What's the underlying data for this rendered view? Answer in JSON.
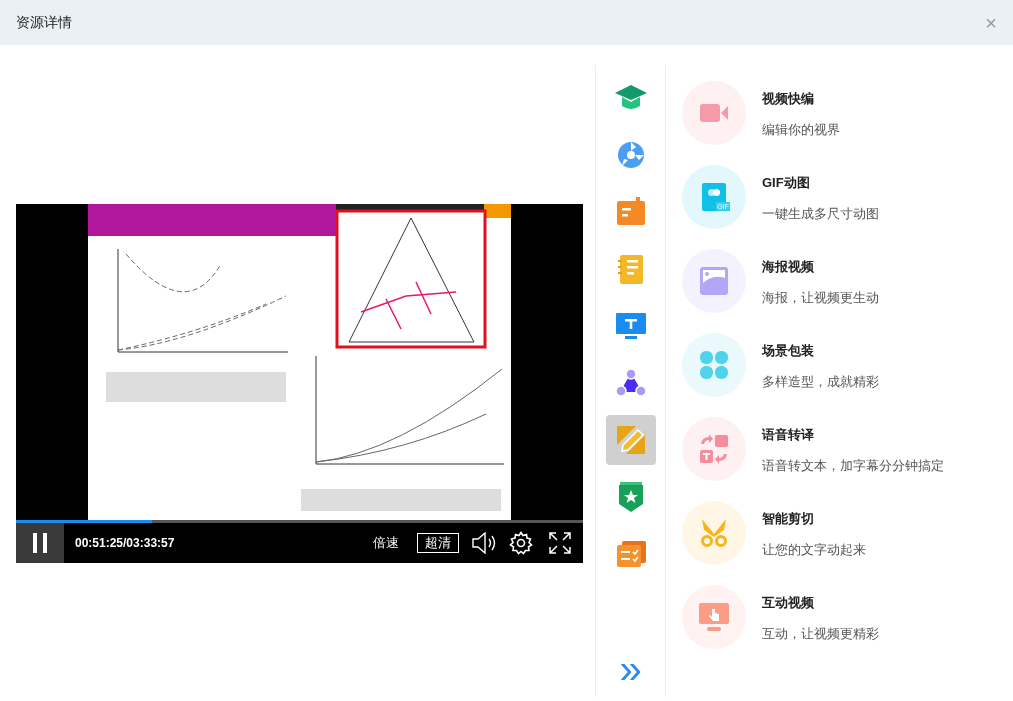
{
  "window": {
    "title": "资源详情",
    "close": "×"
  },
  "player": {
    "playing": true,
    "progress": {
      "level": 0.24
    },
    "time": "00:51:25/03:33:57",
    "speed": "倍速",
    "quality": "超清"
  },
  "sidebar": {
    "items": [
      {
        "kind": "cap",
        "selected": false
      },
      {
        "kind": "fan",
        "selected": false
      },
      {
        "kind": "book",
        "selected": false
      },
      {
        "kind": "notebook",
        "selected": false
      },
      {
        "kind": "monitor",
        "selected": false
      },
      {
        "kind": "share",
        "selected": false
      },
      {
        "kind": "edit",
        "selected": true
      },
      {
        "kind": "badge",
        "selected": false
      },
      {
        "kind": "tasks",
        "selected": false
      }
    ],
    "more": "»"
  },
  "tools": [
    {
      "kind": "video",
      "title": "视频快编",
      "subtitle": "编辑你的视界"
    },
    {
      "kind": "gif",
      "title": "GIF动图",
      "subtitle": "一键生成多尺寸动图",
      "icon_label": "GIF"
    },
    {
      "kind": "poster",
      "title": "海报视频",
      "subtitle": "海报，让视频更生动"
    },
    {
      "kind": "scene",
      "title": "场景包装",
      "subtitle": "多样造型，成就精彩"
    },
    {
      "kind": "speech",
      "title": "语音转译",
      "subtitle": "语音转文本，加字幕分分钟搞定"
    },
    {
      "kind": "cut",
      "title": "智能剪切",
      "subtitle": "让您的文字动起来"
    },
    {
      "kind": "interactive",
      "title": "互动视频",
      "subtitle": "互动，让视频更精彩"
    }
  ]
}
